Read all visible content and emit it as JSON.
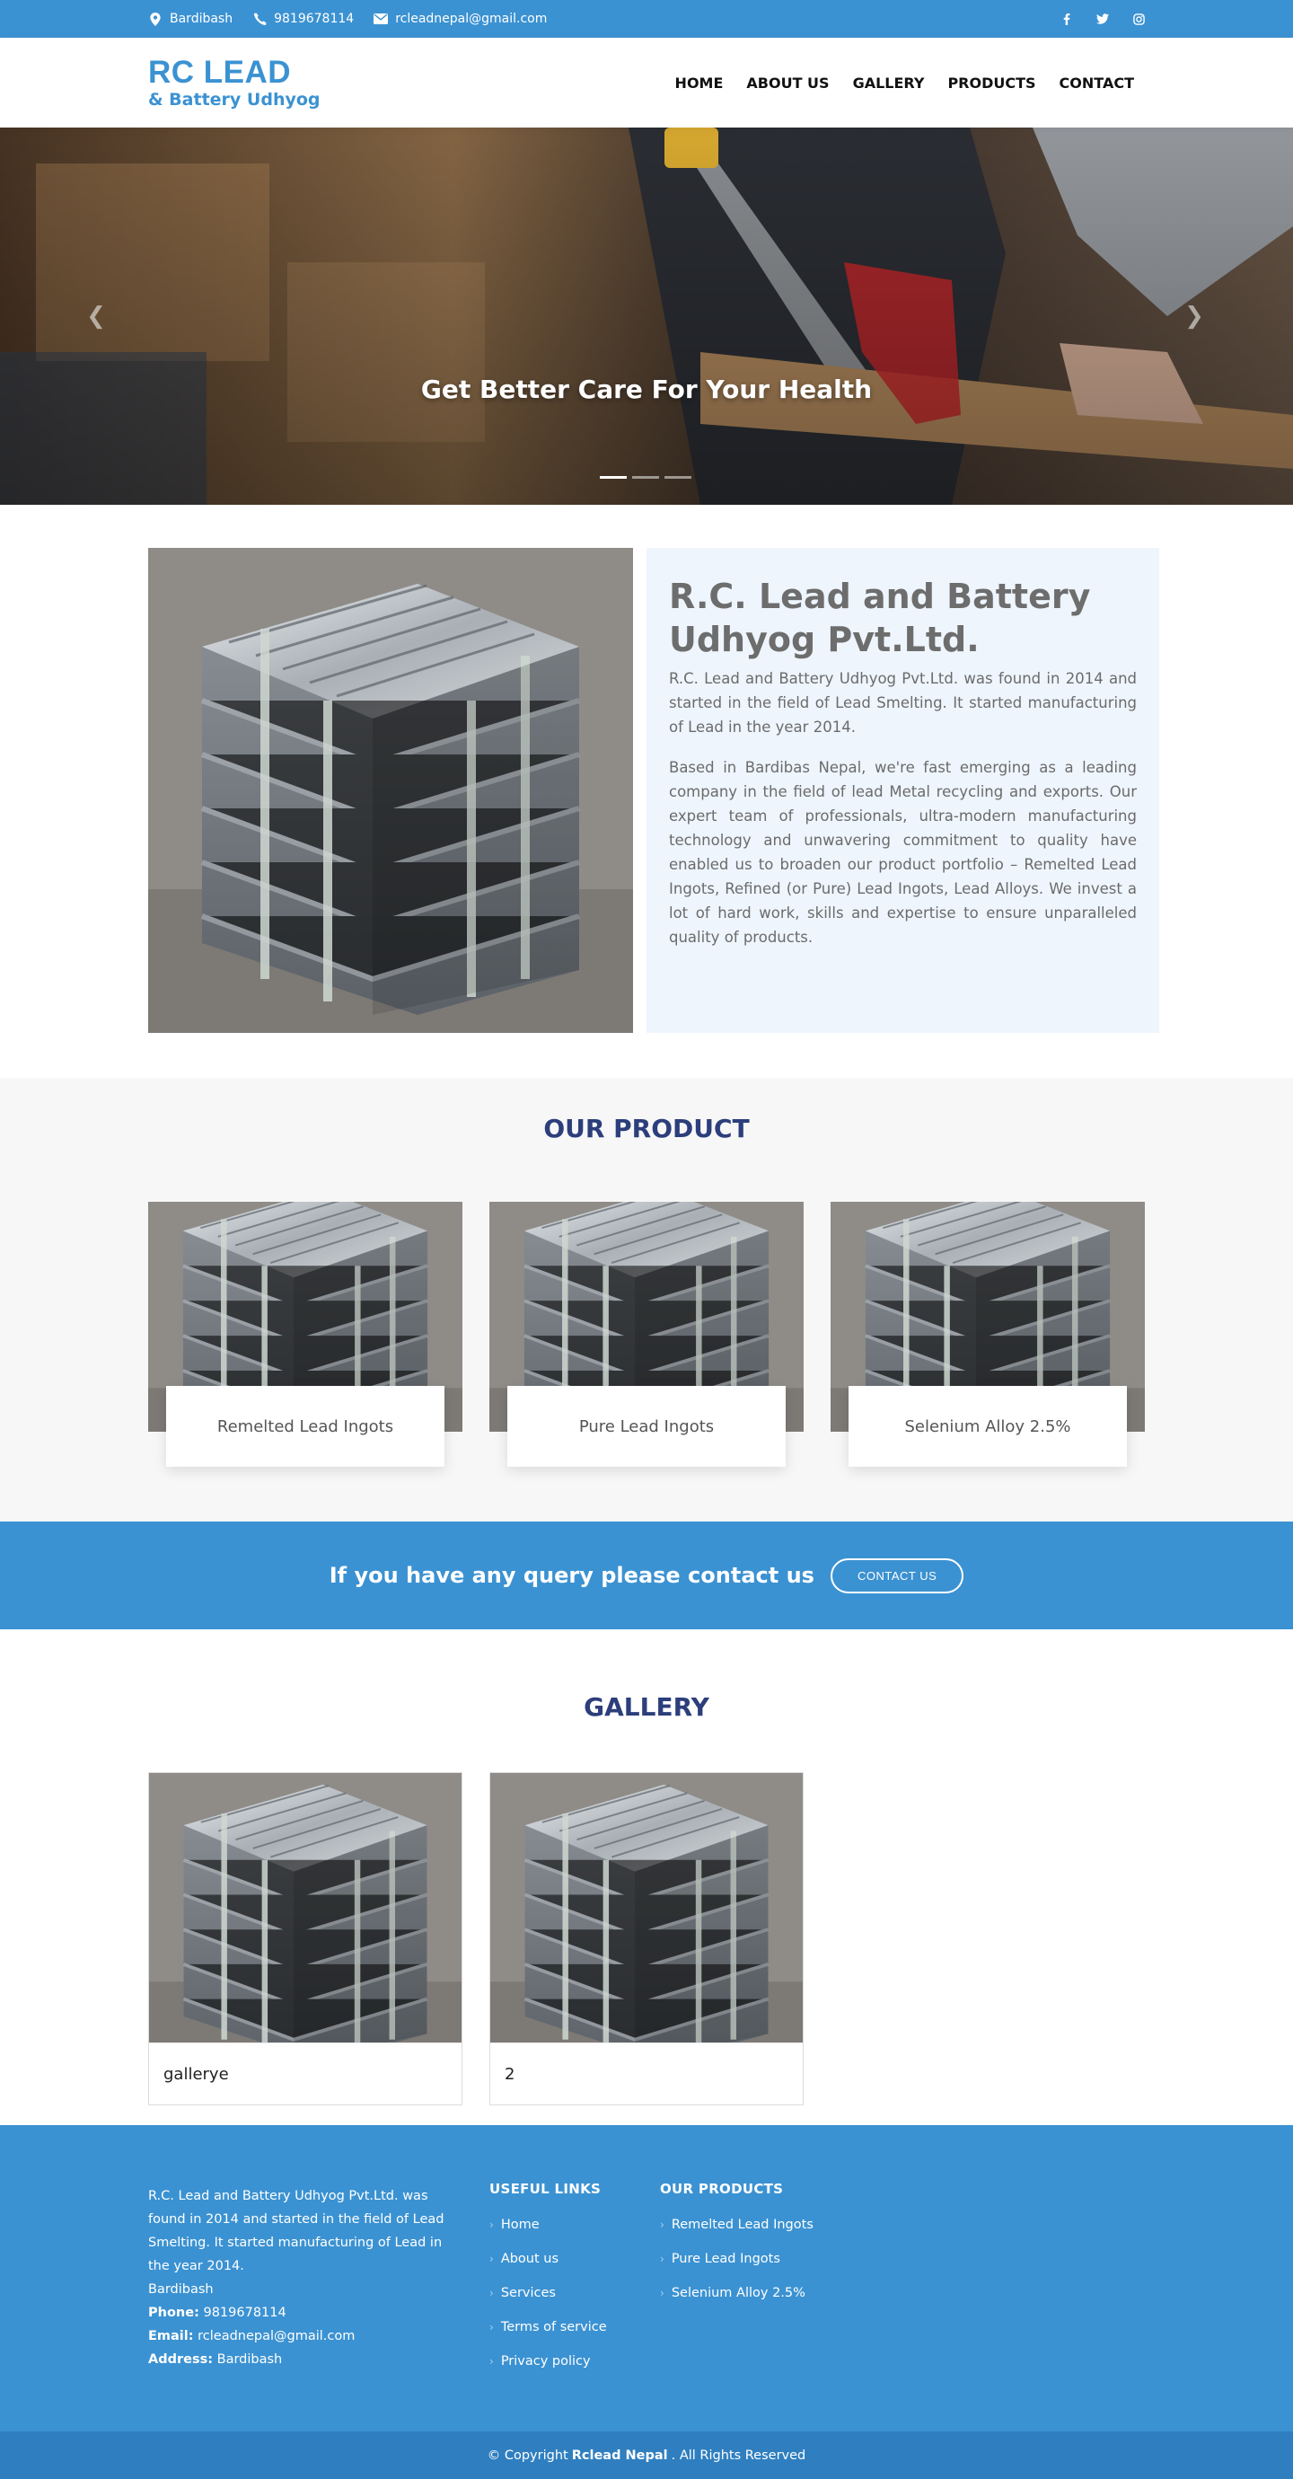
{
  "topbar": {
    "location": "Bardibash",
    "phone": "9819678114",
    "email": "rcleadnepal@gmail.com",
    "social": [
      "facebook-icon",
      "twitter-icon",
      "instagram-icon"
    ]
  },
  "header": {
    "logo_main": "RC LEAD",
    "logo_sub": "& Battery Udhyog",
    "nav": [
      "HOME",
      "ABOUT US",
      "GALLERY",
      "PRODUCTS",
      "CONTACT"
    ]
  },
  "hero": {
    "title": "Get Better Care For Your Health",
    "slides": 3,
    "active_slide": 1
  },
  "about": {
    "title": "R.C. Lead and Battery Udhyog Pvt.Ltd.",
    "para1": "R.C. Lead and Battery Udhyog Pvt.Ltd. was found in 2014 and started in the field of Lead Smelting. It started manufacturing of Lead in the year 2014.",
    "para2": "Based in Bardibas Nepal, we're fast emerging as a leading company in the field of lead Metal recycling and exports. Our expert team of professionals, ultra-modern manufacturing technology and unwavering commitment to quality have enabled us to broaden our product portfolio – Remelted Lead Ingots, Refined (or Pure) Lead Ingots, Lead Alloys. We invest a lot of hard work, skills and expertise to ensure unparalleled quality of products."
  },
  "products": {
    "title": "OUR PRODUCT",
    "items": [
      "Remelted Lead Ingots",
      "Pure Lead Ingots",
      "Selenium Alloy 2.5%"
    ]
  },
  "cta": {
    "text": "If you have any query please contact us",
    "button": "CONTACT US"
  },
  "gallery": {
    "title": "GALLERY",
    "items": [
      "gallerye",
      "2"
    ]
  },
  "footer": {
    "about": "R.C. Lead and Battery Udhyog Pvt.Ltd. was found in 2014 and started in the field of Lead Smelting. It started manufacturing of Lead in the year 2014.",
    "location": "Bardibash",
    "phone_label": "Phone:",
    "phone": "9819678114",
    "email_label": "Email:",
    "email": "rcleadnepal@gmail.com",
    "address_label": "Address:",
    "address": "Bardibash",
    "links_title": "USEFUL LINKS",
    "links": [
      "Home",
      "About us",
      "Services",
      "Terms of service",
      "Privacy policy"
    ],
    "products_title": "OUR PRODUCTS",
    "products": [
      "Remelted Lead Ingots",
      "Pure Lead Ingots",
      "Selenium Alloy 2.5%"
    ]
  },
  "copyright": {
    "prefix": "© Copyright",
    "brand": "Rclead Nepal",
    "suffix": ". All Rights Reserved"
  },
  "colors": {
    "primary": "#3b92d2",
    "title_dark": "#2c3e7b",
    "about_bg": "#eef5fd"
  }
}
